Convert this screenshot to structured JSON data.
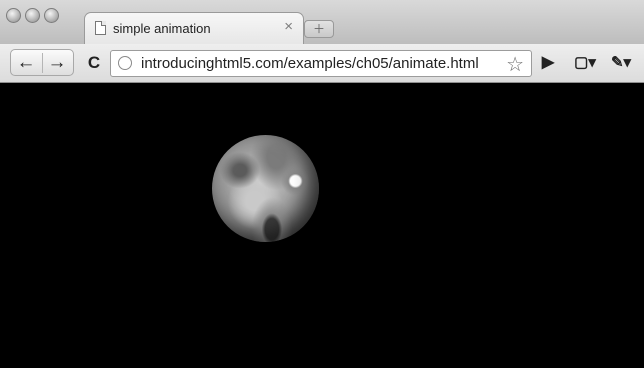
{
  "tab": {
    "title": "simple animation",
    "close_glyph": "×"
  },
  "toolbar": {
    "back_glyph": "←",
    "forward_glyph": "→",
    "reload_glyph": "C",
    "url": "introducinghtml5.com/examples/ch05/animate.html",
    "star_glyph": "☆",
    "play_glyph": "▶",
    "page_menu_glyph": "▢▾",
    "wrench_menu_glyph": "✎▾"
  },
  "content": {
    "background": "#000000"
  }
}
